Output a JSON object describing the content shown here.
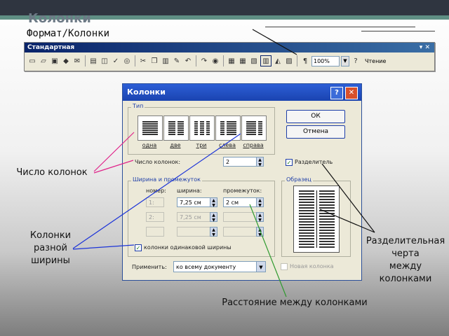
{
  "slide": {
    "title": "Колонки",
    "subtitle": "Формат/Колонки"
  },
  "toolbar": {
    "name": "Стандартная",
    "zoom": "100%",
    "read_label": "Чтение",
    "icons": [
      "new-icon",
      "open-icon",
      "save-icon",
      "permission-icon",
      "email-icon",
      "print-icon",
      "print-preview-icon",
      "spelling-icon",
      "research-icon",
      "cut-icon",
      "copy-icon",
      "paste-icon",
      "format-painter-icon",
      "undo-icon",
      "redo-icon",
      "hyperlink-icon",
      "tables-borders-icon",
      "insert-table-icon",
      "insert-excel-icon",
      "columns-icon",
      "drawing-icon",
      "document-map-icon",
      "show-formatting-icon"
    ]
  },
  "dialog": {
    "title": "Колонки",
    "help": "?",
    "close": "✕",
    "type_group": "Тип",
    "presets": [
      {
        "label": "одна",
        "cols": 1
      },
      {
        "label": "две",
        "cols": 2
      },
      {
        "label": "три",
        "cols": 3
      },
      {
        "label": "слева",
        "cols": 2
      },
      {
        "label": "справа",
        "cols": 2
      }
    ],
    "ok": "ОК",
    "cancel": "Отмена",
    "num_cols_label": "Число колонок:",
    "num_cols_value": "2",
    "separator_label": "Разделитель",
    "separator_checked": true,
    "width_group": "Ширина и промежуток",
    "col_header": "номер:",
    "width_header": "ширина:",
    "gap_header": "промежуток:",
    "rows": [
      {
        "num": "1:",
        "width": "7,25 см",
        "gap": "2 см",
        "enabled": true
      },
      {
        "num": "2:",
        "width": "7,25 см",
        "gap": "",
        "enabled": false
      },
      {
        "num": "",
        "width": "",
        "gap": "",
        "enabled": false
      }
    ],
    "equal_width_label": "колонки одинаковой ширины",
    "equal_width_checked": true,
    "preview_group": "Образец",
    "apply_label": "Применить:",
    "apply_value": "ко всему документу",
    "new_column_label": "Новая колонка",
    "new_column_checked": false
  },
  "annotations": {
    "num_cols": "Число колонок",
    "diff_width": "Колонки\nразной\nширины",
    "separator": "Разделительная\nчерта\nмежду\nколонками",
    "gap": "Расстояние между колонками"
  },
  "colors": {
    "arrow_pink": "#e0238a",
    "arrow_blue": "#1c34d8",
    "arrow_green": "#2e9a2e",
    "arrow_black": "#111111"
  }
}
